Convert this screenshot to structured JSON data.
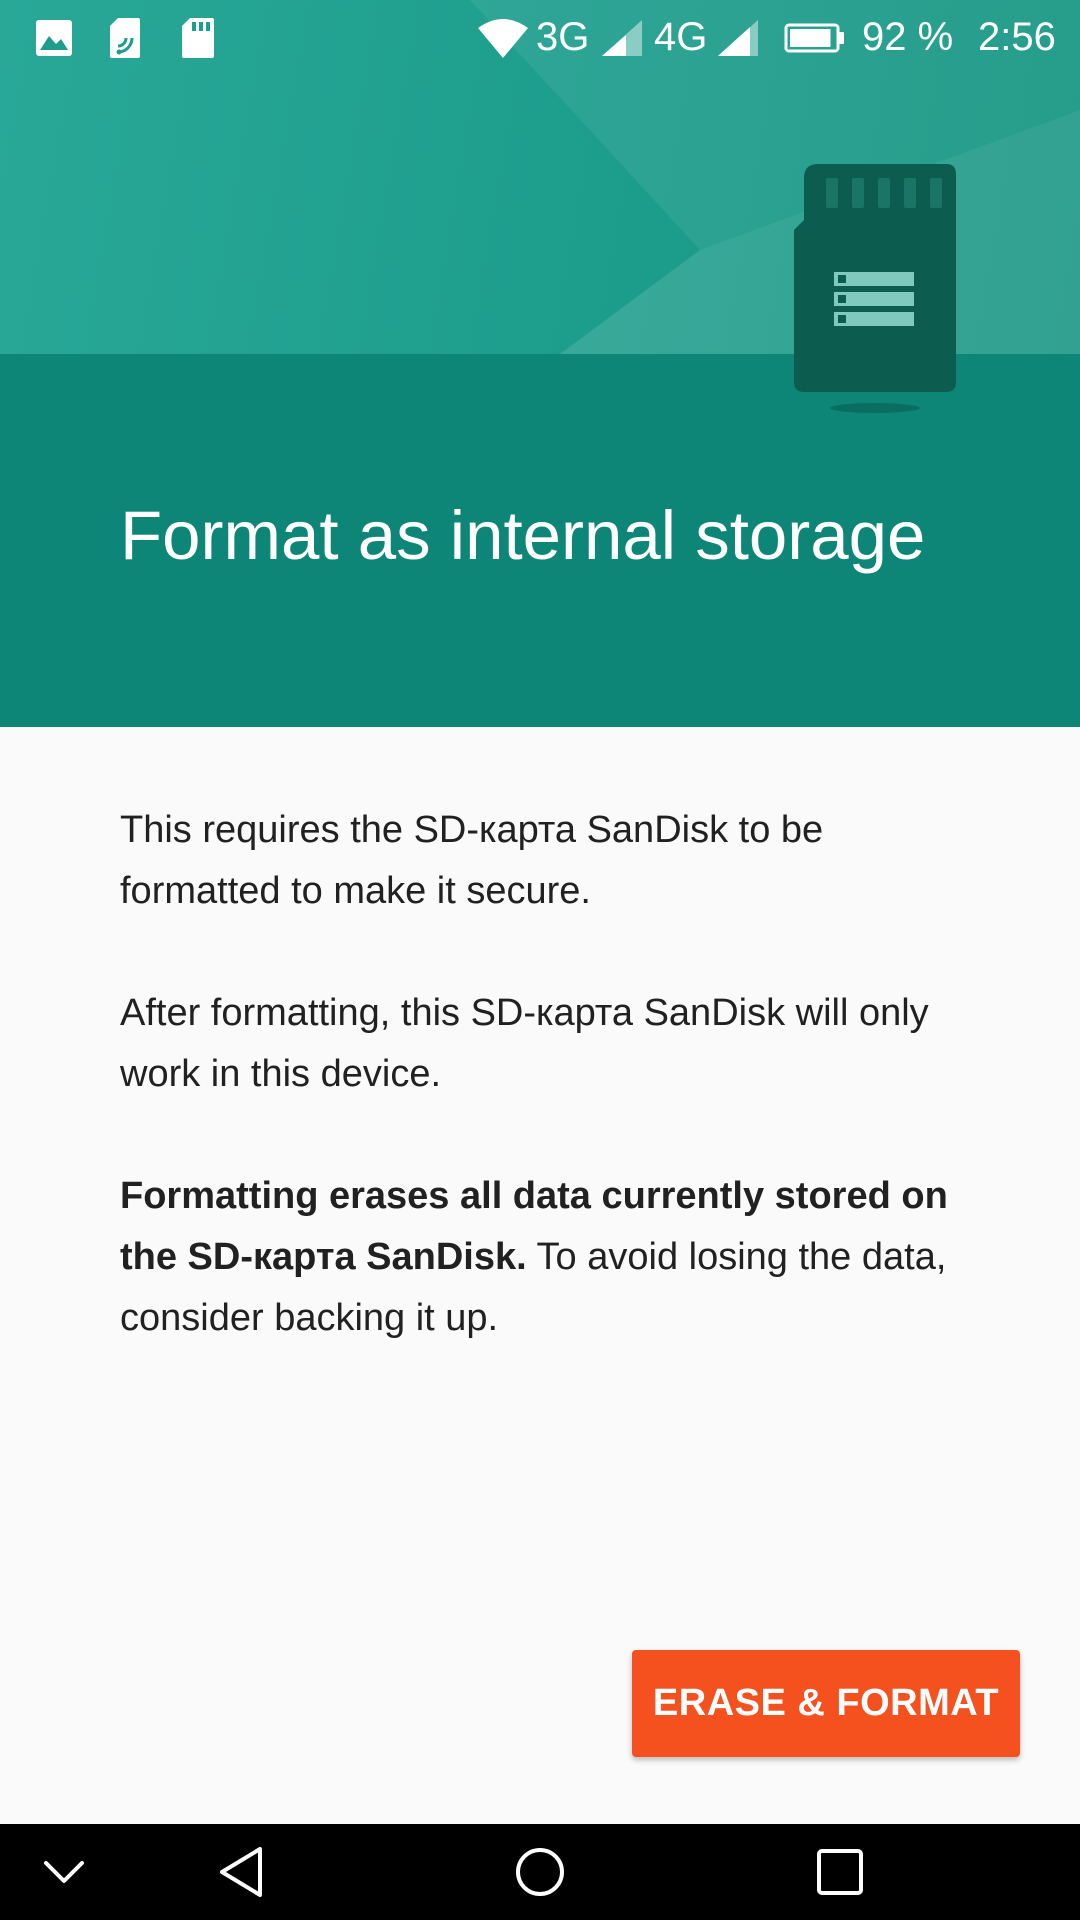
{
  "status_bar": {
    "network_3g": "3G",
    "network_4g": "4G",
    "battery_percent": "92 %",
    "battery_level": 0.92,
    "time": "2:56",
    "notification_icons": [
      "image-icon",
      "sim-card-icon",
      "sd-card-icon"
    ]
  },
  "hero": {
    "title": "Format as internal storage",
    "colors": {
      "top": "#1d9d8c",
      "bottom": "#0e8677",
      "card": "#0d5c50"
    }
  },
  "body": {
    "para1": "This requires the SD-карта SanDisk to be formatted to make it secure.",
    "para2": "After formatting, this SD-карта SanDisk will only work in this device.",
    "para3_bold": "Formatting erases all data currently stored on the SD-карта SanDisk.",
    "para3_rest": " To avoid losing the data, consider backing it up."
  },
  "actions": {
    "erase_format_label": "ERASE & FORMAT",
    "accent_color": "#f4511e"
  },
  "nav_bar": {
    "icons": [
      "chevron-down-icon",
      "back-icon",
      "home-icon",
      "recents-icon"
    ]
  }
}
